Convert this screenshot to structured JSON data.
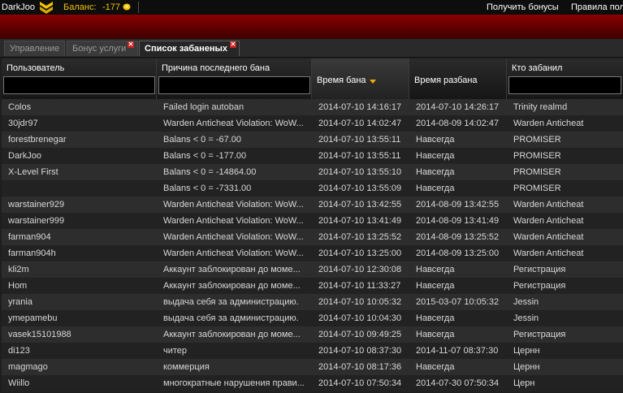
{
  "topbar": {
    "username": "DarkJoo",
    "balance_label": "Баланс:",
    "balance_value": "-177",
    "get_bonus": "Получить бонусы",
    "rules": "Правила пол"
  },
  "tabs": [
    {
      "label": "Управление",
      "active": false,
      "closable": false
    },
    {
      "label": "Бонус услуги",
      "active": false,
      "closable": true
    },
    {
      "label": "Список забаненых",
      "active": true,
      "closable": true
    }
  ],
  "columns": [
    {
      "label": "Пользователь",
      "has_filter": true,
      "filter_value": ""
    },
    {
      "label": "Причина последнего бана",
      "has_filter": true,
      "filter_value": ""
    },
    {
      "label": "Время бана",
      "has_filter": false,
      "sorted": "desc"
    },
    {
      "label": "Время разбана",
      "has_filter": false
    },
    {
      "label": "Кто забанил",
      "has_filter": true,
      "filter_value": ""
    }
  ],
  "rows": [
    [
      "Colos",
      "Failed login autoban",
      "2014-07-10 14:16:17",
      "2014-07-10 14:26:17",
      "Trinity realmd"
    ],
    [
      "30jdr97",
      "Warden Anticheat Violation: WoW...",
      "2014-07-10 14:02:47",
      "2014-08-09 14:02:47",
      "Warden Anticheat"
    ],
    [
      "forestbrenegar",
      "Balans < 0 = -67.00",
      "2014-07-10 13:55:11",
      "Навсегда",
      "PROMISER"
    ],
    [
      "DarkJoo",
      "Balans < 0 = -177.00",
      "2014-07-10 13:55:11",
      "Навсегда",
      "PROMISER"
    ],
    [
      "X-Level First",
      "Balans < 0 = -14864.00",
      "2014-07-10 13:55:10",
      "Навсегда",
      "PROMISER"
    ],
    [
      "",
      "Balans < 0 = -7331.00",
      "2014-07-10 13:55:09",
      "Навсегда",
      "PROMISER"
    ],
    [
      "warstainer929",
      "Warden Anticheat Violation: WoW...",
      "2014-07-10 13:42:55",
      "2014-08-09 13:42:55",
      "Warden Anticheat"
    ],
    [
      "warstainer999",
      "Warden Anticheat Violation: WoW...",
      "2014-07-10 13:41:49",
      "2014-08-09 13:41:49",
      "Warden Anticheat"
    ],
    [
      "farman904",
      "Warden Anticheat Violation: WoW...",
      "2014-07-10 13:25:52",
      "2014-08-09 13:25:52",
      "Warden Anticheat"
    ],
    [
      "farman904h",
      "Warden Anticheat Violation: WoW...",
      "2014-07-10 13:25:00",
      "2014-08-09 13:25:00",
      "Warden Anticheat"
    ],
    [
      "kli2m",
      "Аккаунт заблокирован до моме...",
      "2014-07-10 12:30:08",
      "Навсегда",
      "Регистрация"
    ],
    [
      "Hom",
      "Аккаунт заблокирован до моме...",
      "2014-07-10 11:33:27",
      "Навсегда",
      "Регистрация"
    ],
    [
      "yrania",
      "выдача себя за администрацию.",
      "2014-07-10 10:05:32",
      "2015-03-07 10:05:32",
      "Jessin"
    ],
    [
      "ymepamebu",
      "выдача себя за администрацию.",
      "2014-07-10 10:04:30",
      "Навсегда",
      "Jessin"
    ],
    [
      "vasek15101988",
      "Аккаунт заблокирован до моме...",
      "2014-07-10 09:49:25",
      "Навсегда",
      "Регистрация"
    ],
    [
      "di123",
      "читер",
      "2014-07-10 08:37:30",
      "2014-11-07 08:37:30",
      "Цернн"
    ],
    [
      "magmago",
      "коммерция",
      "2014-07-10 08:17:36",
      "Навсегда",
      "Цернн"
    ],
    [
      "Wiillo",
      "многократные нарушения прави...",
      "2014-07-10 07:50:34",
      "2014-07-30 07:50:34",
      "Церн"
    ]
  ],
  "colors": {
    "accent": "#f2c200",
    "red_band": "#8a0000",
    "close": "#c42020"
  },
  "icons": {
    "rank": "chevron-rank-icon",
    "coin": "coin-icon",
    "close": "close-icon",
    "sort": "sort-desc-icon"
  }
}
